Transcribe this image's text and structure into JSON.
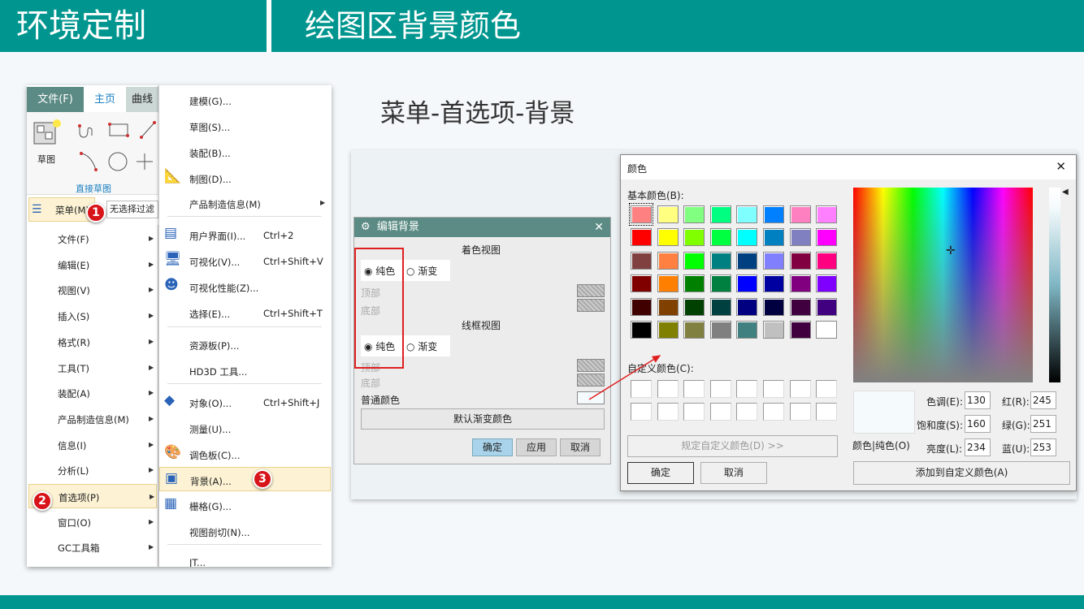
{
  "header": {
    "section": "环境定制",
    "title": "绘图区背景颜色"
  },
  "subtitle": "菜单-首选项-背景",
  "ribbon": {
    "tabs": [
      "文件(F)",
      "主页",
      "曲线"
    ],
    "sketch_label": "草图",
    "group_label": "直接草图",
    "menu_button": "菜单(M)",
    "filter": "无选择过滤"
  },
  "main_menu": [
    "文件(F)",
    "编辑(E)",
    "视图(V)",
    "插入(S)",
    "格式(R)",
    "工具(T)",
    "装配(A)",
    "产品制造信息(M)",
    "信息(I)",
    "分析(L)",
    "首选项(P)",
    "窗口(O)",
    "GC工具箱"
  ],
  "submenu": [
    {
      "label": "建模(G)...",
      "shortcut": ""
    },
    {
      "label": "草图(S)...",
      "shortcut": ""
    },
    {
      "label": "装配(B)...",
      "shortcut": ""
    },
    {
      "label": "制图(D)...",
      "shortcut": ""
    },
    {
      "label": "产品制造信息(M)",
      "shortcut": ""
    },
    {
      "label": "用户界面(I)...",
      "shortcut": "Ctrl+2"
    },
    {
      "label": "可视化(V)...",
      "shortcut": "Ctrl+Shift+V"
    },
    {
      "label": "可视化性能(Z)...",
      "shortcut": ""
    },
    {
      "label": "选择(E)...",
      "shortcut": "Ctrl+Shift+T"
    },
    {
      "label": "资源板(P)...",
      "shortcut": ""
    },
    {
      "label": "HD3D 工具...",
      "shortcut": ""
    },
    {
      "label": "对象(O)...",
      "shortcut": "Ctrl+Shift+J"
    },
    {
      "label": "测量(U)...",
      "shortcut": ""
    },
    {
      "label": "调色板(C)...",
      "shortcut": ""
    },
    {
      "label": "背景(A)...",
      "shortcut": ""
    },
    {
      "label": "栅格(G)...",
      "shortcut": ""
    },
    {
      "label": "视图剖切(N)...",
      "shortcut": ""
    },
    {
      "label": "JT...",
      "shortcut": ""
    }
  ],
  "badges": [
    "1",
    "2",
    "3"
  ],
  "edit_bg": {
    "title": "编辑背景",
    "shaded": "着色视图",
    "wire": "线框视图",
    "solid": "纯色",
    "gradient": "渐变",
    "top": "顶部",
    "bottom": "底部",
    "plain": "普通颜色",
    "default_btn": "默认渐变颜色",
    "ok": "确定",
    "apply": "应用",
    "cancel": "取消"
  },
  "color_dialog": {
    "title": "颜色",
    "basic": "基本颜色(B):",
    "custom": "自定义颜色(C):",
    "define": "规定自定义颜色(D) >>",
    "ok": "确定",
    "cancel": "取消",
    "solid": "颜色|纯色(O)",
    "add": "添加到自定义颜色(A)",
    "hue_label": "色调(E):",
    "hue": "130",
    "sat_label": "饱和度(S):",
    "sat": "160",
    "lum_label": "亮度(L):",
    "lum": "234",
    "red_label": "红(R):",
    "red": "245",
    "green_label": "绿(G):",
    "green": "251",
    "blue_label": "蓝(U):",
    "blue": "253",
    "basic_colors": [
      "#FF8080",
      "#FFFF80",
      "#80FF80",
      "#00FF80",
      "#80FFFF",
      "#0080FF",
      "#FF80C0",
      "#FF80FF",
      "#FF0000",
      "#FFFF00",
      "#80FF00",
      "#00FF40",
      "#00FFFF",
      "#0080C0",
      "#8080C0",
      "#FF00FF",
      "#804040",
      "#FF8040",
      "#00FF00",
      "#008080",
      "#004080",
      "#8080FF",
      "#800040",
      "#FF0080",
      "#800000",
      "#FF8000",
      "#008000",
      "#008040",
      "#0000FF",
      "#0000A0",
      "#800080",
      "#8000FF",
      "#400000",
      "#804000",
      "#004000",
      "#004040",
      "#000080",
      "#000040",
      "#400040",
      "#400080",
      "#000000",
      "#808000",
      "#808040",
      "#808080",
      "#408080",
      "#C0C0C0",
      "#400040",
      "#FFFFFF"
    ],
    "selected_color": "#F5FBFD"
  }
}
